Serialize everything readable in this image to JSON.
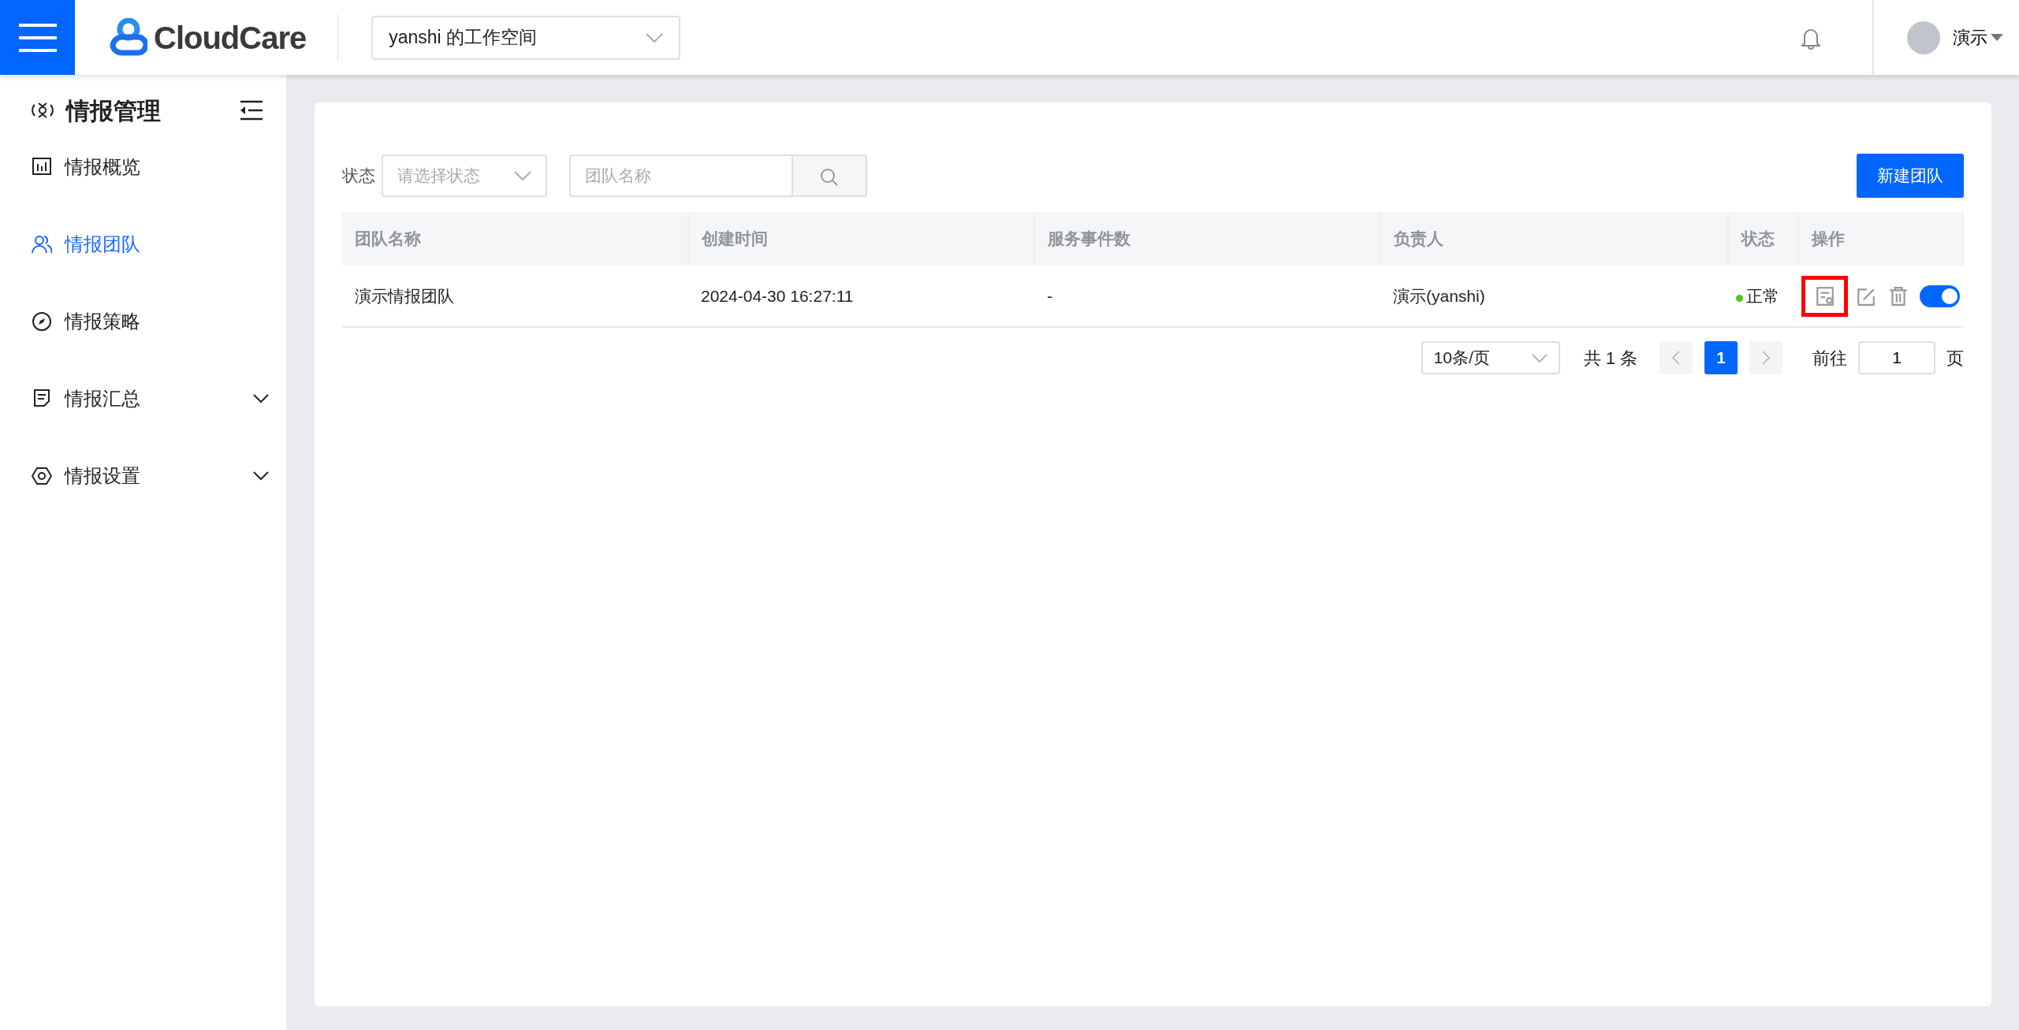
{
  "header": {
    "brand": "CloudCare",
    "workspace": "yanshi 的工作空间",
    "user": "演示"
  },
  "sidebar": {
    "title": "情报管理",
    "items": [
      {
        "label": "情报概览",
        "kind": "chart",
        "selected": false,
        "expandable": false
      },
      {
        "label": "情报团队",
        "kind": "people",
        "selected": true,
        "expandable": false
      },
      {
        "label": "情报策略",
        "kind": "compass",
        "selected": false,
        "expandable": false
      },
      {
        "label": "情报汇总",
        "kind": "note",
        "selected": false,
        "expandable": true
      },
      {
        "label": "情报设置",
        "kind": "hexagon",
        "selected": false,
        "expandable": true
      }
    ]
  },
  "filters": {
    "status_label": "状态",
    "status_placeholder": "请选择状态",
    "name_placeholder": "团队名称",
    "new_button": "新建团队"
  },
  "table": {
    "columns": [
      "团队名称",
      "创建时间",
      "服务事件数",
      "负责人",
      "状态",
      "操作"
    ],
    "rows": [
      {
        "name": "演示情报团队",
        "created": "2024-04-30 16:27:11",
        "events": "-",
        "owner": "演示(yanshi)",
        "status": "正常",
        "color": "#52c41a",
        "actions": [
          {
            "kind": "view",
            "highlighted": true
          },
          {
            "kind": "edit",
            "highlighted": false
          },
          {
            "kind": "delete",
            "highlighted": false
          }
        ],
        "on": true
      }
    ]
  },
  "pagination": {
    "page_size": "10条/页",
    "total": "共 1 条",
    "pages": [
      {
        "label": "1",
        "selected": true
      }
    ],
    "goto_label": "前往",
    "goto_value": "1",
    "page_unit": "页"
  }
}
